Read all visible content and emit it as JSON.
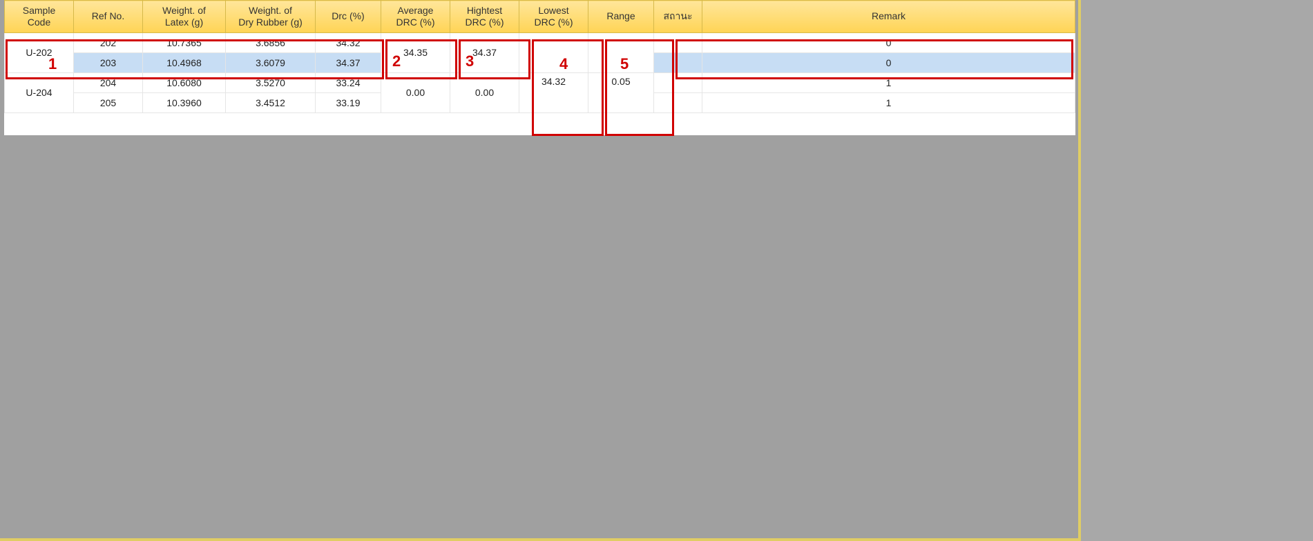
{
  "headers": {
    "sample_code": "Sample\nCode",
    "ref_no": "Ref No.",
    "weight_latex": "Weight. of\nLatex (g)",
    "weight_dry": "Weight. of\nDry Rubber (g)",
    "drc": "Drc (%)",
    "avg_drc": "Average\nDRC (%)",
    "hi_drc": "Hightest\nDRC (%)",
    "lo_drc": "Lowest\nDRC (%)",
    "range": "Range",
    "status": "สถานะ",
    "remark": "Remark"
  },
  "groups": [
    {
      "sample_code": "U-202",
      "avg_drc": "34.35",
      "hi_drc": "34.37",
      "lo_drc": "",
      "range": "",
      "rows": [
        {
          "ref": "202",
          "wl": "10.7365",
          "wdr": "3.6856",
          "drc": "34.32",
          "status": "",
          "remark": "0",
          "hl": false
        },
        {
          "ref": "203",
          "wl": "10.4968",
          "wdr": "3.6079",
          "drc": "34.37",
          "status": "",
          "remark": "0",
          "hl": true
        }
      ]
    },
    {
      "sample_code": "U-204",
      "avg_drc": "0.00",
      "hi_drc": "0.00",
      "lo_drc": "34.32",
      "range": "0.05",
      "rows": [
        {
          "ref": "204",
          "wl": "10.6080",
          "wdr": "3.5270",
          "drc": "33.24",
          "status": "",
          "remark": "1",
          "hl": false
        },
        {
          "ref": "205",
          "wl": "10.3960",
          "wdr": "3.4512",
          "drc": "33.19",
          "status": "",
          "remark": "1",
          "hl": false
        }
      ]
    }
  ],
  "annotations": {
    "n1": "1",
    "n2": "2",
    "n3": "3",
    "n4": "4",
    "n5": "5"
  }
}
